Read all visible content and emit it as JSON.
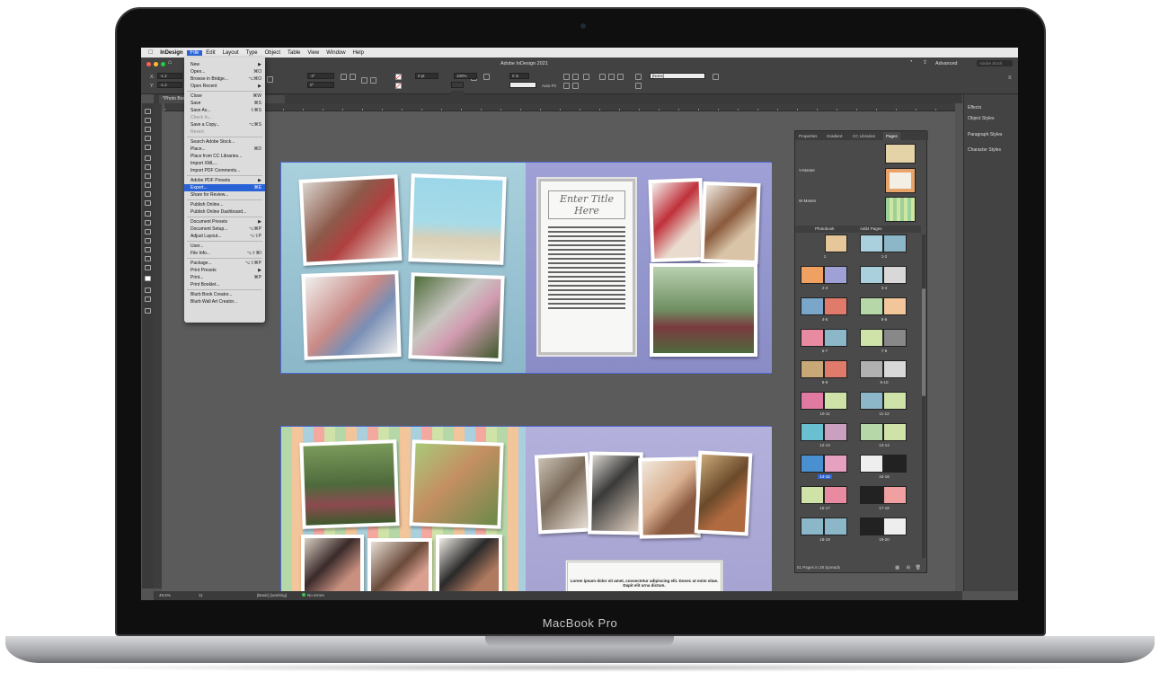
{
  "device": {
    "brand": "MacBook Pro"
  },
  "app": {
    "window_title": "Adobe InDesign 2021",
    "workspace": "Advanced",
    "search_placeholder": "Adobe Stock",
    "menu": [
      "InDesign",
      "File",
      "Edit",
      "Layout",
      "Type",
      "Object",
      "Table",
      "View",
      "Window",
      "Help"
    ],
    "active_menu": "File"
  },
  "control": {
    "x": "-1.2",
    "y": "-1.2",
    "w": "36.01717",
    "h": "36.01717",
    "angle": "-2°",
    "shear": "0°",
    "stroke": "0 pt",
    "offset": "0 in",
    "zoom": "100%",
    "fit": "Auto-Fit",
    "style": "[None]"
  },
  "document_tab": "*Photo Book 2021 @ 49.5% [GPU Preview]",
  "file_menu": [
    {
      "label": "New",
      "shortcut": "▶",
      "state": "normal"
    },
    {
      "label": "Open...",
      "shortcut": "⌘O",
      "state": "normal"
    },
    {
      "label": "Browse in Bridge...",
      "shortcut": "⌥⌘O",
      "state": "normal"
    },
    {
      "label": "Open Recent",
      "shortcut": "▶",
      "state": "normal"
    },
    {
      "sep": true
    },
    {
      "label": "Close",
      "shortcut": "⌘W",
      "state": "normal"
    },
    {
      "label": "Save",
      "shortcut": "⌘S",
      "state": "normal"
    },
    {
      "label": "Save As...",
      "shortcut": "⇧⌘S",
      "state": "normal"
    },
    {
      "label": "Check In...",
      "shortcut": "",
      "state": "disabled"
    },
    {
      "label": "Save a Copy...",
      "shortcut": "⌥⌘S",
      "state": "normal"
    },
    {
      "label": "Revert",
      "shortcut": "",
      "state": "disabled"
    },
    {
      "sep": true
    },
    {
      "label": "Search Adobe Stock...",
      "shortcut": "",
      "state": "normal"
    },
    {
      "label": "Place...",
      "shortcut": "⌘D",
      "state": "normal"
    },
    {
      "label": "Place from CC Libraries...",
      "shortcut": "",
      "state": "normal"
    },
    {
      "label": "Import XML...",
      "shortcut": "",
      "state": "normal"
    },
    {
      "label": "Import PDF Comments...",
      "shortcut": "",
      "state": "normal"
    },
    {
      "sep": true
    },
    {
      "label": "Adobe PDF Presets",
      "shortcut": "▶",
      "state": "normal"
    },
    {
      "label": "Export...",
      "shortcut": "⌘E",
      "state": "highlighted"
    },
    {
      "label": "Share for Review...",
      "shortcut": "",
      "state": "normal"
    },
    {
      "sep": true
    },
    {
      "label": "Publish Online...",
      "shortcut": "",
      "state": "normal"
    },
    {
      "label": "Publish Online Dashboard...",
      "shortcut": "",
      "state": "normal"
    },
    {
      "sep": true
    },
    {
      "label": "Document Presets",
      "shortcut": "▶",
      "state": "normal"
    },
    {
      "label": "Document Setup...",
      "shortcut": "⌥⌘P",
      "state": "normal"
    },
    {
      "label": "Adjust Layout...",
      "shortcut": "⌥⇧P",
      "state": "normal"
    },
    {
      "sep": true
    },
    {
      "label": "User...",
      "shortcut": "",
      "state": "normal"
    },
    {
      "label": "File Info...",
      "shortcut": "⌥⇧⌘I",
      "state": "normal"
    },
    {
      "sep": true
    },
    {
      "label": "Package...",
      "shortcut": "⌥⇧⌘P",
      "state": "normal"
    },
    {
      "label": "Print Presets",
      "shortcut": "▶",
      "state": "normal"
    },
    {
      "label": "Print...",
      "shortcut": "⌘P",
      "state": "normal"
    },
    {
      "label": "Print Booklet...",
      "shortcut": "",
      "state": "normal"
    },
    {
      "sep": true
    },
    {
      "label": "Blurb Book Creator...",
      "shortcut": "",
      "state": "normal"
    },
    {
      "label": "Blurb Wall Art Creator...",
      "shortcut": "",
      "state": "normal"
    }
  ],
  "pages_panel": {
    "tabs": [
      "Properties",
      "Gradient",
      "CC Libraries",
      "Pages"
    ],
    "active_tab": "Pages",
    "masters": [
      "V-Master",
      "W-Master"
    ],
    "header_left": "Photobook",
    "header_right": "Add4 Pages",
    "spreads": [
      "1",
      "1-2",
      "2-3",
      "3-4",
      "4-5",
      "5-6",
      "6-7",
      "7-8",
      "8-9",
      "9-10",
      "10-11",
      "11-12",
      "12-13",
      "13-14",
      "14-15",
      "15-16",
      "16-17",
      "17-18",
      "18-19",
      "19-20"
    ],
    "selected_spread": "14-15",
    "footer": "51 Pages in 29 Spreads"
  },
  "dock": [
    "Effects",
    "Object Styles",
    "Paragraph Styles",
    "Character Styles"
  ],
  "layout": {
    "title_placeholder": "Enter Title Here",
    "caption_text": "Lorem ipsum dolor sit amet, consectetur adipiscing elit. Donec ut enim vitae. Dapit elit urna dictum."
  },
  "status": {
    "zoom": "49.5%",
    "page": "11",
    "style": "[Basic] (working)",
    "errors": "No errors"
  },
  "colors": {
    "accent": "#2a63d8",
    "page_blue": "#8fb8c9",
    "page_violet": "#8f90c8",
    "page_lavender": "#a8a5d1"
  }
}
